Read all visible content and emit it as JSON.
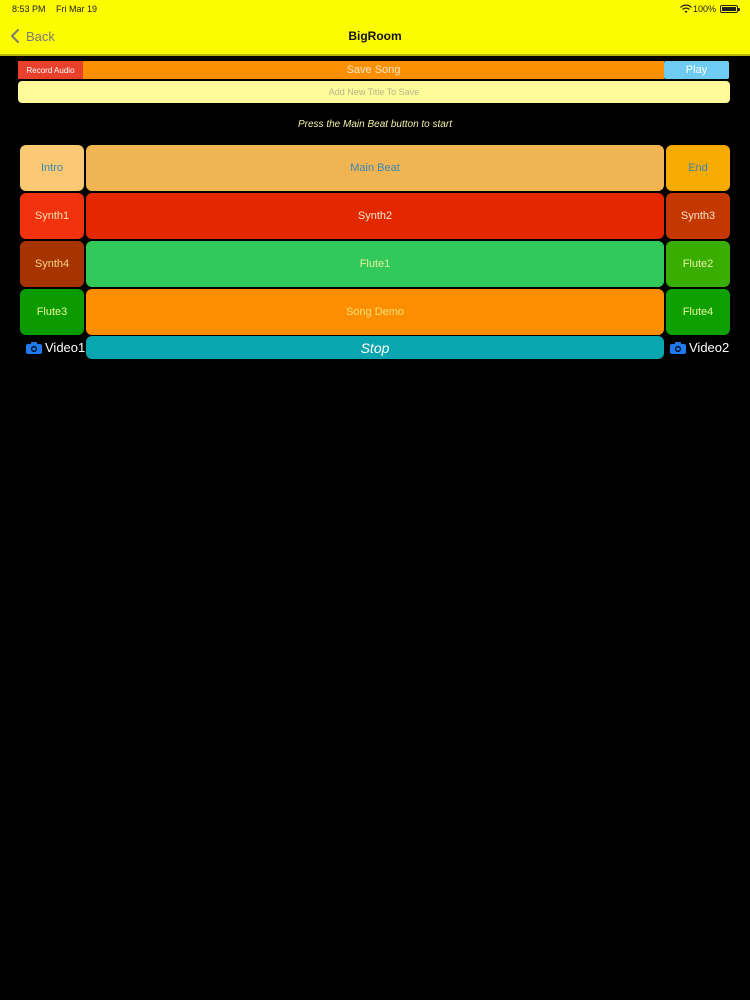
{
  "status": {
    "time": "8:53 PM",
    "date": "Fri Mar 19",
    "battery": "100%",
    "icons": [
      "wifi-icon",
      "battery-icon"
    ]
  },
  "nav": {
    "back_label": "Back",
    "title": "BigRoom"
  },
  "controls": {
    "record_label": "Record Audio",
    "save_label": "Save Song",
    "play_label": "Play",
    "title_placeholder": "Add New Title To Save"
  },
  "hint": "Press the Main Beat button to start",
  "pads": {
    "intro": "Intro",
    "main_beat": "Main Beat",
    "end": "End",
    "synth1": "Synth1",
    "synth2": "Synth2",
    "synth3": "Synth3",
    "synth4": "Synth4",
    "flute1": "Flute1",
    "flute2": "Flute2",
    "flute3": "Flute3",
    "song_demo": "Song Demo",
    "flute4": "Flute4"
  },
  "bottom": {
    "video1": "Video1",
    "stop": "Stop",
    "video2": "Video2"
  },
  "colors": {
    "nav_bg": "#fdfb00",
    "record": "#e8402b",
    "save": "#fa8f00",
    "play": "#6ecbf2",
    "intro": "#fbc873",
    "main_beat": "#f0b453",
    "end": "#f7aa00",
    "synth1": "#f2320d",
    "synth2": "#e32800",
    "synth3": "#c43800",
    "synth4": "#a73300",
    "flute1": "#33c95a",
    "flute2": "#3aae00",
    "flute3": "#0b9a00",
    "song_demo": "#fd8e00",
    "flute4": "#0ea000",
    "stop": "#0aa6b0",
    "camera": "#1d7bf2"
  }
}
